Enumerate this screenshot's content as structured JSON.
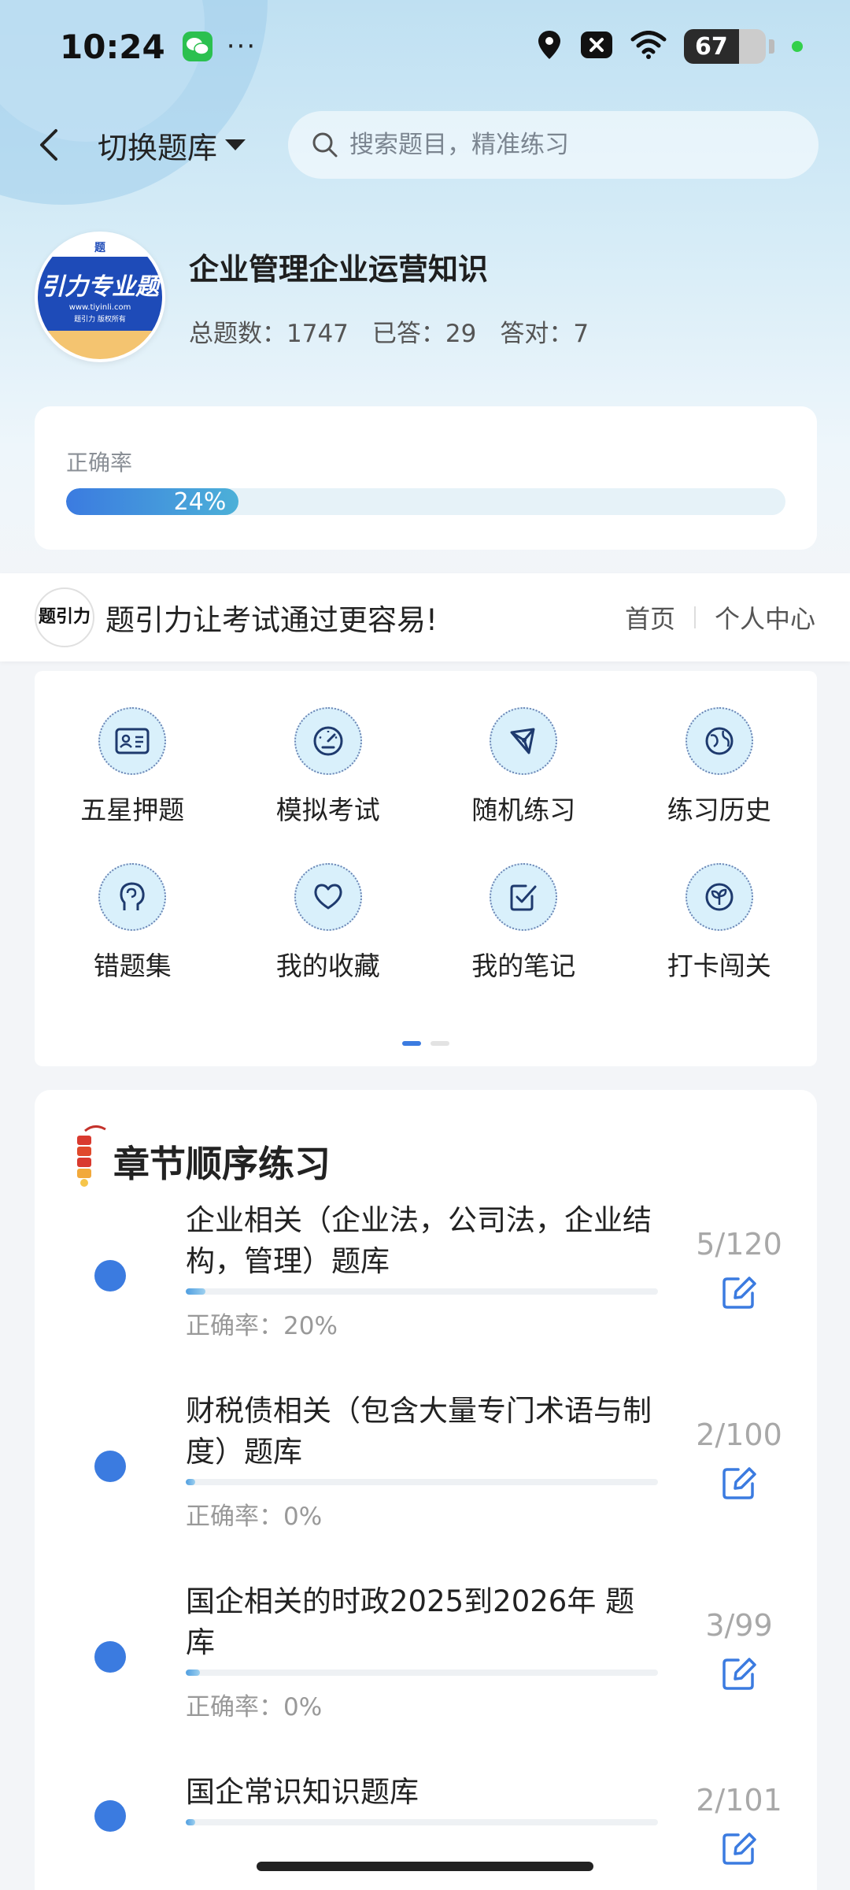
{
  "status_bar": {
    "time": "10:24",
    "dots": "···",
    "battery": "67",
    "icons": [
      "wechat-icon",
      "location-icon",
      "notification-x-icon",
      "wifi-icon",
      "battery-icon"
    ]
  },
  "topnav": {
    "switch_label": "切换题库",
    "search_placeholder": "搜索题目，精准练习"
  },
  "bank": {
    "title": "企业管理企业运营知识",
    "total": "总题数：1747",
    "answered": "已答：29",
    "correct": "答对：7",
    "logo": {
      "top": "题",
      "main": "引力专业题",
      "url": "www.tiyinli.com",
      "sub": "题引力 版权所有"
    }
  },
  "accuracy": {
    "label": "正确率",
    "value_text": "24%",
    "value": 24
  },
  "slogan": {
    "logo_text": "题引力",
    "text": "题引力让考试通过更容易!",
    "home": "首页",
    "profile": "个人中心"
  },
  "features": [
    {
      "label": "五星押题",
      "icon": "id-card-icon"
    },
    {
      "label": "模拟考试",
      "icon": "gauge-icon"
    },
    {
      "label": "随机练习",
      "icon": "network-icon"
    },
    {
      "label": "练习历史",
      "icon": "globe-icon"
    },
    {
      "label": "错题集",
      "icon": "head-icon"
    },
    {
      "label": "我的收藏",
      "icon": "heart-icon"
    },
    {
      "label": "我的笔记",
      "icon": "note-check-icon"
    },
    {
      "label": "打卡闯关",
      "icon": "sprout-icon"
    }
  ],
  "chapters": {
    "title": "章节顺序练习",
    "items": [
      {
        "name": "企业相关（企业法，公司法，企业结构，管理）题库",
        "acc": "正确率：20%",
        "count": "5/120",
        "progress": 0.042
      },
      {
        "name": "财税债相关（包含大量专门术语与制度）题库",
        "acc": "正确率：0%",
        "count": "2/100",
        "progress": 0.02
      },
      {
        "name": "国企相关的时政2025到2026年 题库",
        "acc": "正确率：0%",
        "count": "3/99",
        "progress": 0.03
      },
      {
        "name": "国企常识知识题库",
        "acc": "",
        "count": "2/101",
        "progress": 0.02
      }
    ]
  },
  "colors": {
    "accent": "#3b7be0",
    "icon_bg": "#d9f0fb",
    "icon_stroke": "#1e3a6e"
  }
}
